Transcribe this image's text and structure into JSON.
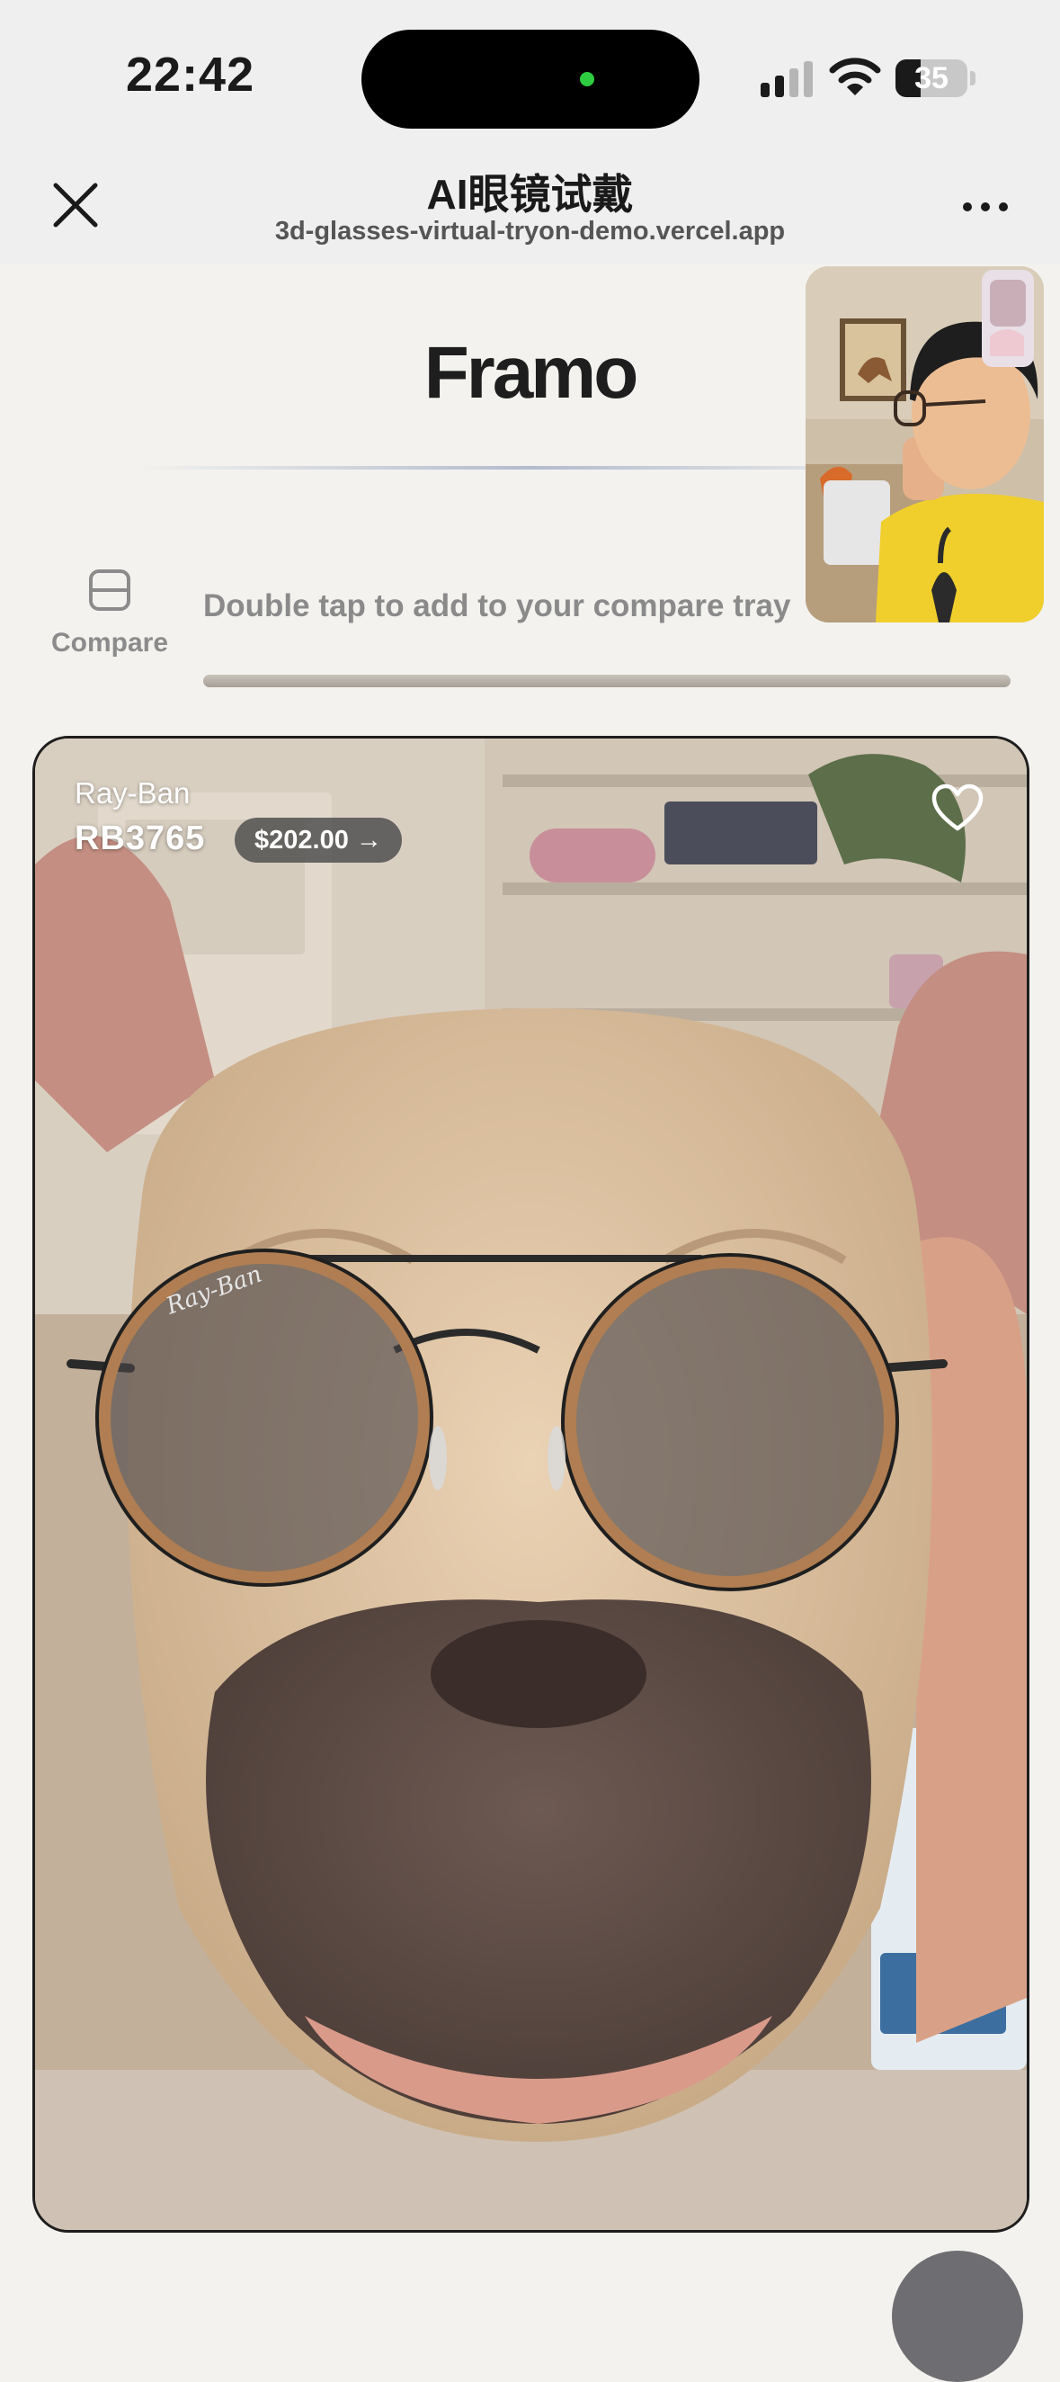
{
  "status_bar": {
    "time": "22:42",
    "battery_level": "35",
    "battery_fraction": 0.35
  },
  "nav": {
    "title": "AI眼镜试戴",
    "url": "3d-glasses-virtual-tryon-demo.vercel.app",
    "close_icon": "close-icon",
    "more_icon": "more-icon"
  },
  "app": {
    "brand": "Framo"
  },
  "compare": {
    "label": "Compare",
    "hint": "Double tap to add to your compare tray"
  },
  "product": {
    "brand": "Ray-Ban",
    "model": "RB3765",
    "price_label": "$202.00 →",
    "favorite_icon": "heart-icon"
  },
  "colors": {
    "background": "#f3f2ef",
    "bar_background": "#efefef",
    "card_border": "#1e1e1e",
    "price_chip": "#505050",
    "glasses_frame": "#b07e52"
  }
}
